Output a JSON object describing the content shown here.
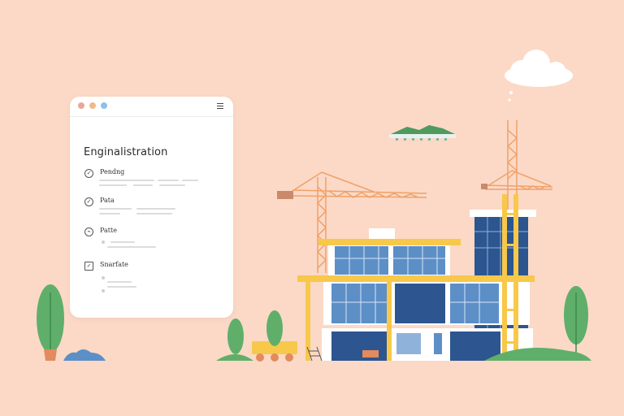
{
  "window": {
    "heading": "Enginalistration",
    "controls": {
      "close_color": "#e8a79a",
      "minimize_color": "#f0b98c",
      "maximize_color": "#8fc0e8"
    },
    "menu_icon": "hamburger-icon",
    "items": [
      {
        "icon": "circle-check-icon",
        "glyph": "✓",
        "label": "Pendng"
      },
      {
        "icon": "circle-check-icon",
        "glyph": "✓",
        "label": "Pata"
      },
      {
        "icon": "circle-arrow-icon",
        "glyph": "⌁",
        "label": "Patte"
      },
      {
        "icon": "square-check-icon",
        "glyph": "✓",
        "label": "Snarfate"
      }
    ]
  },
  "colors": {
    "background": "#fbd9c6",
    "crane": "#f0a169",
    "scaffold": "#f7c84a",
    "glass": "#5d8fc7",
    "glass_dark": "#2d5590",
    "plant": "#5faf6a",
    "cloud": "#ffffff"
  }
}
